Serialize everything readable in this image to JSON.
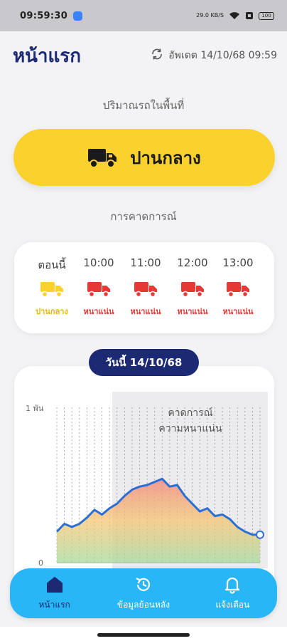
{
  "status_bar": {
    "time": "09:59:30",
    "data_speed": "29.0 KB/S",
    "battery": "100"
  },
  "header": {
    "title": "หน้าแรก",
    "updated_text": "อัพเดต 14/10/68 09:59",
    "refresh_icon": "refresh-icon"
  },
  "current": {
    "section_label": "ปริมาณรถในพื้นที่",
    "status": "ปานกลาง",
    "icon": "truck-icon",
    "color": "#fbd22d"
  },
  "forecast": {
    "section_label": "การคาดการณ์",
    "items": [
      {
        "time": "ตอนนี้",
        "status": "ปานกลาง",
        "color": "#fbd22d"
      },
      {
        "time": "10:00",
        "status": "หนาแน่น",
        "color": "#e53935"
      },
      {
        "time": "11:00",
        "status": "หนาแน่น",
        "color": "#e53935"
      },
      {
        "time": "12:00",
        "status": "หนาแน่น",
        "color": "#e53935"
      },
      {
        "time": "13:00",
        "status": "หนาแน่น",
        "color": "#e53935"
      }
    ]
  },
  "chart": {
    "date_label": "วันนี้ 14/10/68",
    "forecast_label_line1": "คาดการณ์",
    "forecast_label_line2": "ความหนาแน่น"
  },
  "chart_data": {
    "type": "area",
    "title": "",
    "ylim": [
      0,
      1000
    ],
    "y_ticks": [
      "0",
      "1 พัน"
    ],
    "series": [
      {
        "values": [
          200,
          250,
          230,
          250,
          290,
          340,
          310,
          350,
          380,
          430,
          470,
          490,
          500,
          520,
          540,
          490,
          500,
          430,
          380,
          330,
          350,
          300,
          310,
          280,
          230,
          200,
          180,
          180
        ]
      }
    ],
    "forecast_start_index": 11,
    "line_color": "#2b6fd6",
    "grid": true
  },
  "nav": {
    "items": [
      {
        "label": "หน้าแรก",
        "icon": "home-icon",
        "active": true
      },
      {
        "label": "ข้อมูลย้อนหลัง",
        "icon": "history-icon",
        "active": false
      },
      {
        "label": "แจ้งเตือน",
        "icon": "bell-icon",
        "active": false
      }
    ]
  }
}
